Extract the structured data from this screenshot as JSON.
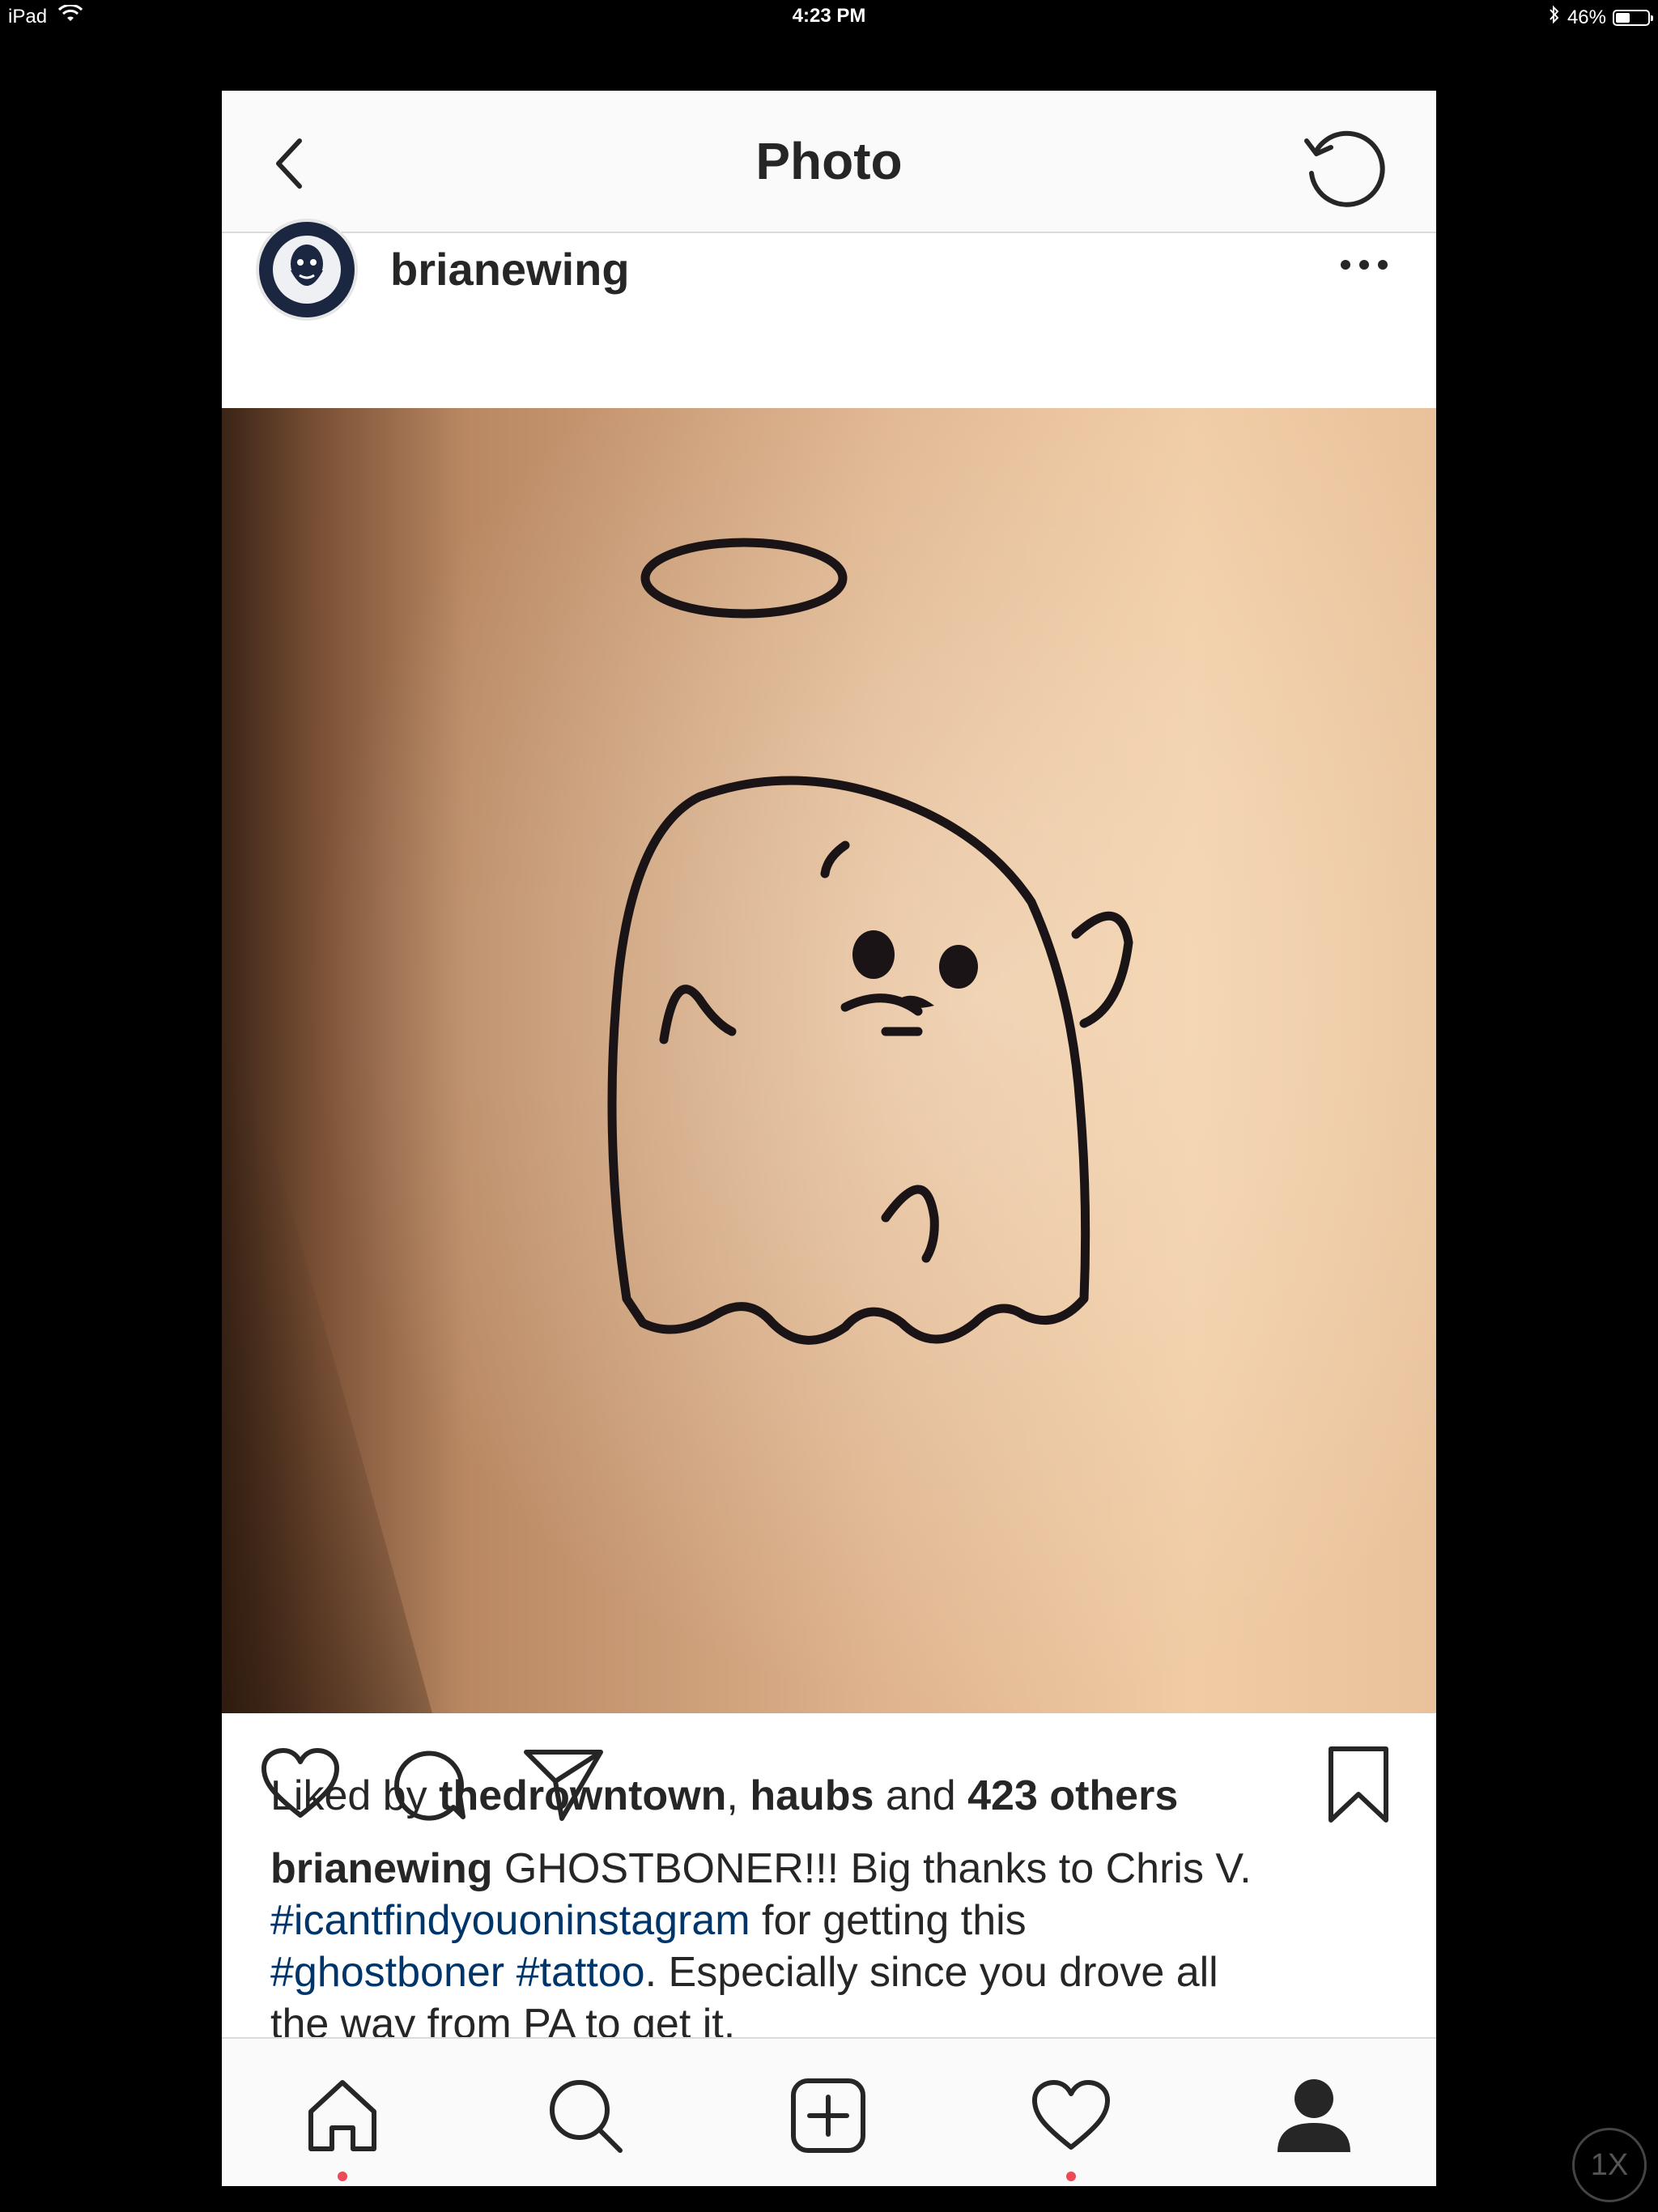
{
  "status_bar": {
    "device": "iPad",
    "time": "4:23 PM",
    "battery_text": "46%",
    "battery_level": 0.46
  },
  "header": {
    "title": "Photo"
  },
  "post": {
    "username": "brianewing",
    "likes": {
      "prefix": "Liked by ",
      "user1": "thedrowntown",
      "separator": ", ",
      "user2": "haubs",
      "and": " and ",
      "others": "423 others"
    },
    "caption": {
      "username": "brianewing",
      "line1_text": " GHOSTBONER!!! Big thanks to Chris V.",
      "tag1": "#icantfindyouoninstagram",
      "line2_text": " for getting this",
      "tag2": "#ghostboner",
      "tag3": "#tattoo",
      "line3_text": ". Especially since you drove all",
      "line4_text": "the way from PA to get it."
    }
  },
  "tabs": [
    "home",
    "search",
    "new-post",
    "activity",
    "profile"
  ],
  "zoom_badge": "1X",
  "colors": {
    "accent_link": "#003569",
    "notification_dot": "#ed4956",
    "text": "#262626"
  }
}
